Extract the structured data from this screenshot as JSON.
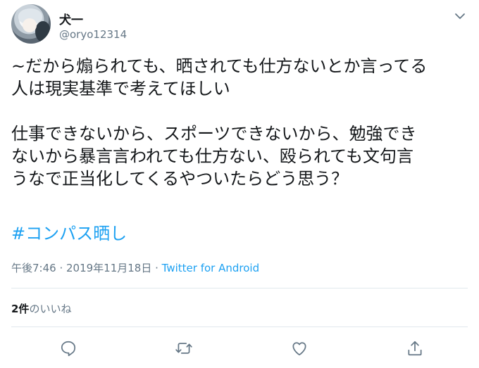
{
  "user": {
    "display_name": "犬一",
    "handle": "@oryo12314"
  },
  "tweet": {
    "text": "~だから煽られても、晒されても仕方ないとか言ってる\n人は現実基準で考えてほしい\n\n仕事できないから、スポーツできないから、勉強でき\nないから暴言言われても仕方ない、殴られても文句言\nうなで正当化してくるやついたらどう思う？",
    "hashtag": "#コンパス晒し"
  },
  "meta": {
    "time": "午後7:46",
    "sep1": " · ",
    "date": "2019年11月18日",
    "sep2": " · ",
    "source": "Twitter for Android"
  },
  "likes": {
    "count": "2件",
    "label": "のいいね"
  },
  "icons": {
    "menu": "chevron-down-icon",
    "reply": "reply-icon",
    "retweet": "retweet-icon",
    "like": "heart-icon",
    "share": "share-icon"
  },
  "colors": {
    "accent": "#1da1f2",
    "secondary_text": "#657786",
    "icon": "#657786",
    "divider": "#e1e8ed"
  }
}
